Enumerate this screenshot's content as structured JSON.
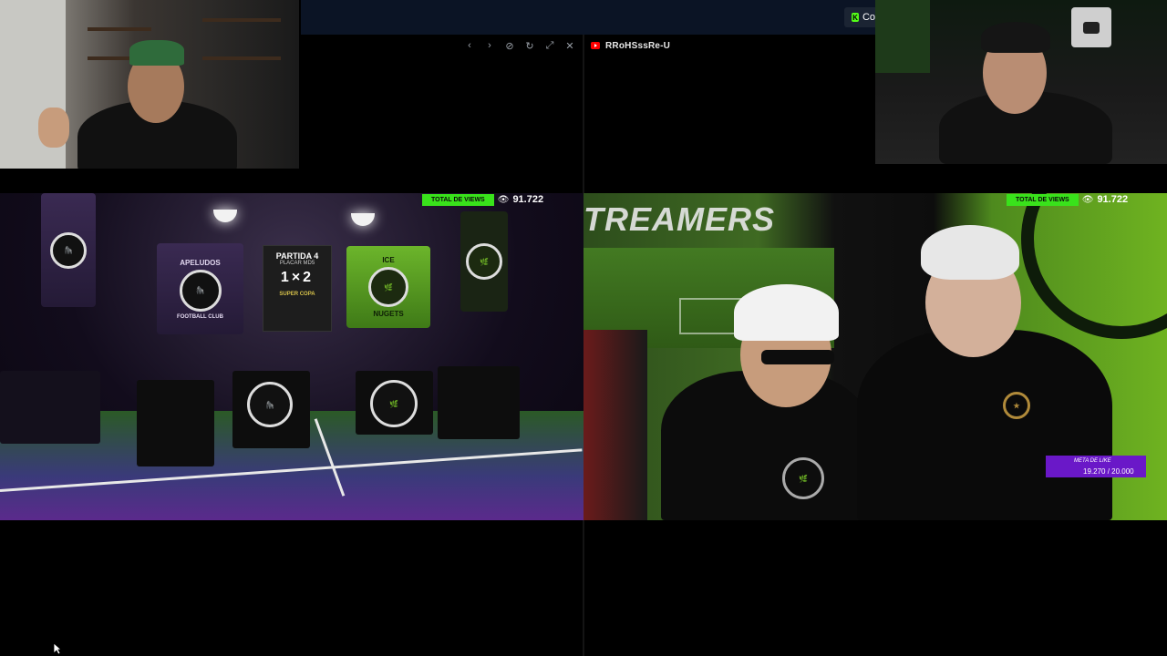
{
  "topbar": {
    "kick_label": "Co"
  },
  "left_pane": {
    "controls": [
      "chevron-left",
      "chevron-right",
      "hide",
      "refresh",
      "expand",
      "close"
    ]
  },
  "right_pane": {
    "video_id": "RRoHSssRe-U"
  },
  "left_stream": {
    "views_label": "TOTAL DE VIEWS",
    "views_count": "91.722",
    "scoreboard": {
      "partida": "PARTIDA 4",
      "placar": "PLACAR MD5",
      "score": "1×2",
      "cup": "SUPER COPA"
    },
    "banners": {
      "apeludos": "APELUDOS",
      "apeludos_sub": "FOOTBALL CLUB",
      "ice": "ICE",
      "nugets": "NUGETS"
    }
  },
  "right_stream": {
    "streamers_text": "TREAMERS",
    "views_label": "TOTAL DE VIEWS",
    "views_count": "91.722",
    "like_goal": {
      "title": "META DE LIKE",
      "value": "19.270 / 20.000"
    }
  },
  "colors": {
    "accent_green": "#39e21b",
    "like_purple": "#6a18c8",
    "topbar_bg": "#0b1425"
  }
}
